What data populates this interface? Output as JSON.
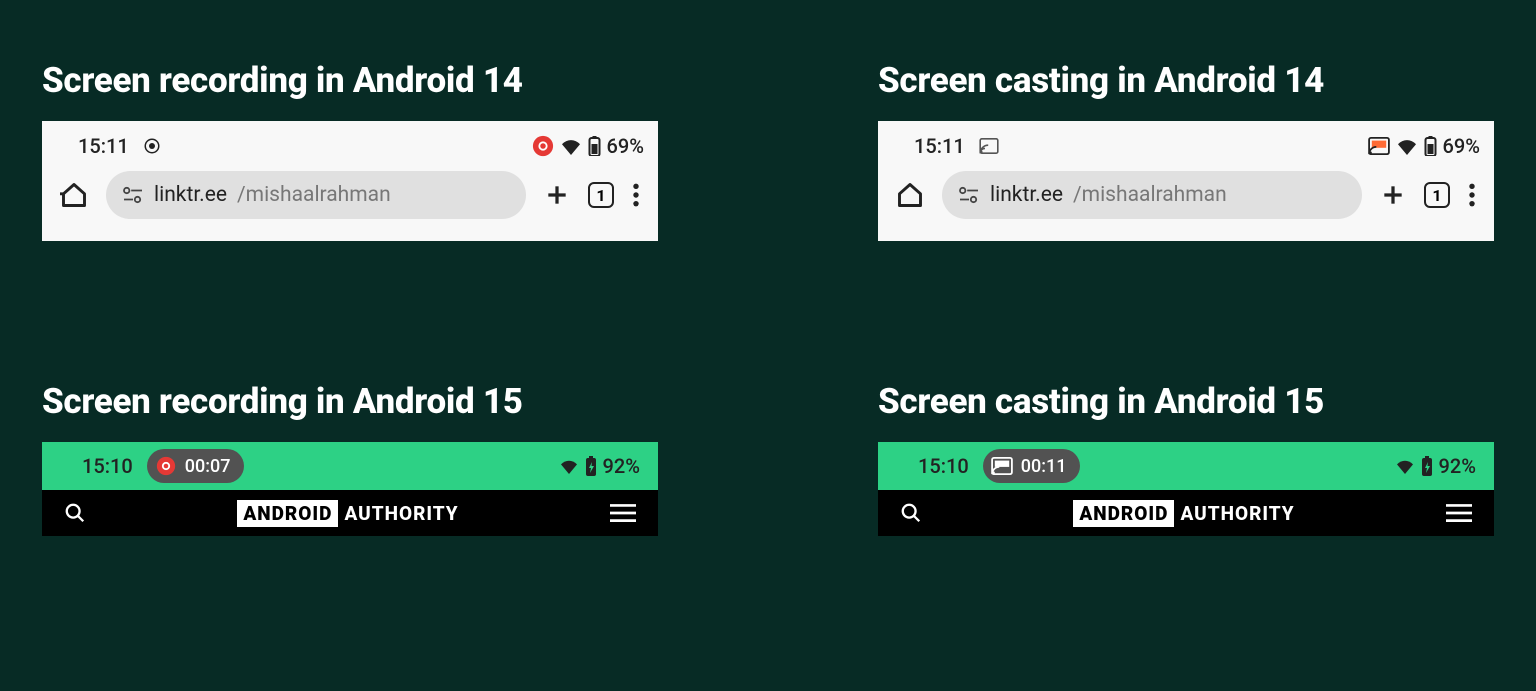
{
  "panels": {
    "rec14": {
      "title": "Screen recording in Android 14",
      "time": "15:11",
      "battery": "69%",
      "url_domain": "linktr.ee",
      "url_path": "/mishaalrahman",
      "tabs": "1"
    },
    "cast14": {
      "title": "Screen casting in Android 14",
      "time": "15:11",
      "battery": "69%",
      "url_domain": "linktr.ee",
      "url_path": "/mishaalrahman",
      "tabs": "1"
    },
    "rec15": {
      "title": "Screen recording in Android 15",
      "time": "15:10",
      "chip_time": "00:07",
      "battery": "92%",
      "brand_a": "ANDROID",
      "brand_b": "AUTHORITY"
    },
    "cast15": {
      "title": "Screen casting in Android 15",
      "time": "15:10",
      "chip_time": "00:11",
      "battery": "92%",
      "brand_a": "ANDROID",
      "brand_b": "AUTHORITY"
    }
  }
}
